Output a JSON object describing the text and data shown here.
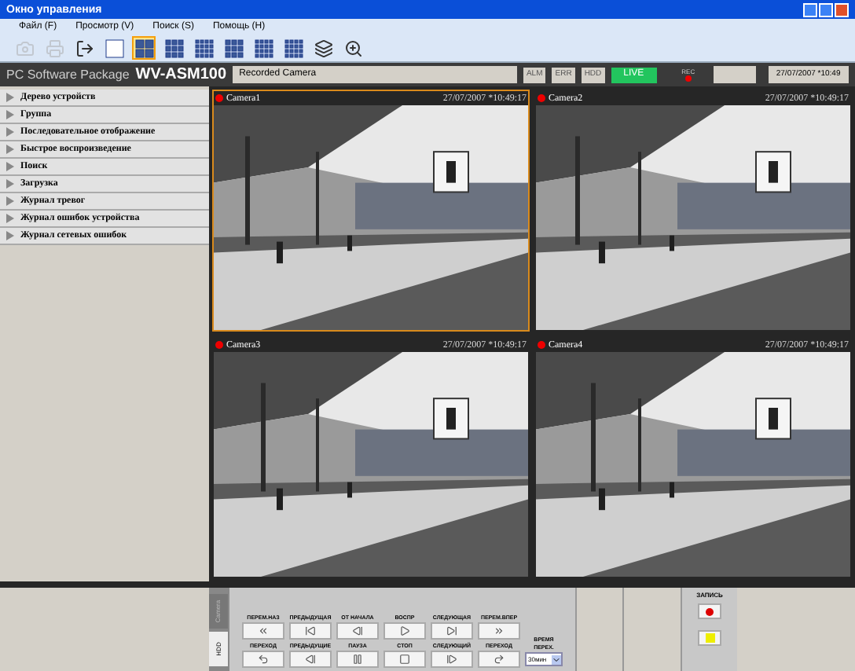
{
  "window": {
    "title": "Окно управления"
  },
  "menu": [
    "Файл (F)",
    "Просмотр (V)",
    "Поиск (S)",
    "Помощь (H)"
  ],
  "toolbar": [
    {
      "kind": "camera",
      "disabled": true,
      "selected": false
    },
    {
      "kind": "print",
      "disabled": true,
      "selected": false
    },
    {
      "kind": "exit",
      "disabled": false,
      "selected": false
    },
    {
      "kind": "grid1",
      "disabled": false,
      "selected": false
    },
    {
      "kind": "grid4",
      "disabled": false,
      "selected": true
    },
    {
      "kind": "grid9",
      "disabled": false,
      "selected": false
    },
    {
      "kind": "grid16",
      "disabled": false,
      "selected": false
    },
    {
      "kind": "grid6",
      "disabled": false,
      "selected": false
    },
    {
      "kind": "grid8",
      "disabled": false,
      "selected": false
    },
    {
      "kind": "grid13",
      "disabled": false,
      "selected": false
    },
    {
      "kind": "sequence",
      "disabled": false,
      "selected": false
    },
    {
      "kind": "zoom",
      "disabled": false,
      "selected": false
    }
  ],
  "header": {
    "brand": "PC Software Package",
    "model": "WV-ASM100",
    "status": "Recorded Camera",
    "buttons": [
      "ALM",
      "ERR",
      "HDD"
    ],
    "live": "LIVE",
    "rec_label": "REC",
    "datetime": "27/07/2007 *10:49"
  },
  "sidebar": {
    "items": [
      "Дерево устройств",
      "Группа",
      "Последовательное отображение",
      "Быстрое воспроизведение",
      "Поиск",
      "Загрузка",
      "Журнал тревог",
      "Журнал ошибок устройства",
      "Журнал сетевых ошибок"
    ]
  },
  "cameras": [
    {
      "name": "Camera1",
      "time": "27/07/2007 *10:49:17",
      "selected": true
    },
    {
      "name": "Camera2",
      "time": "27/07/2007 *10:49:17",
      "selected": false
    },
    {
      "name": "Camera3",
      "time": "27/07/2007 *10:49:17",
      "selected": false
    },
    {
      "name": "Camera4",
      "time": "27/07/2007 *10:49:17",
      "selected": false
    }
  ],
  "controls": {
    "side_tabs": [
      {
        "label": "Camera",
        "selected": false
      },
      {
        "label": "HDD",
        "selected": true
      }
    ],
    "rows": [
      [
        {
          "label": "ПЕРЕМ.НАЗ",
          "kind": "rewind"
        },
        {
          "label": "ПРЕДЫДУЩАЯ",
          "kind": "prev"
        },
        {
          "label": "ОТ НАЧАЛА",
          "kind": "first"
        },
        {
          "label": "ВОСПР",
          "kind": "play"
        },
        {
          "label": "СЛЕДУЮЩАЯ",
          "kind": "next"
        },
        {
          "label": "ПЕРЕМ.ВПЕР",
          "kind": "forward"
        }
      ],
      [
        {
          "label": "ПЕРЕХОД",
          "kind": "jump_back"
        },
        {
          "label": "ПРЕДЫДУЩИЕ",
          "kind": "step_back"
        },
        {
          "label": "ПАУЗА",
          "kind": "pause"
        },
        {
          "label": "СТОП",
          "kind": "stop"
        },
        {
          "label": "СЛЕДУЮЩИЙ",
          "kind": "step_forward"
        },
        {
          "label": "ПЕРЕХОД",
          "kind": "jump_forward"
        }
      ]
    ],
    "skip": {
      "label": "ВРЕМЯ ПЕРЕХ.",
      "value": "30мин"
    },
    "record": {
      "label": "ЗАПИСЬ"
    }
  }
}
